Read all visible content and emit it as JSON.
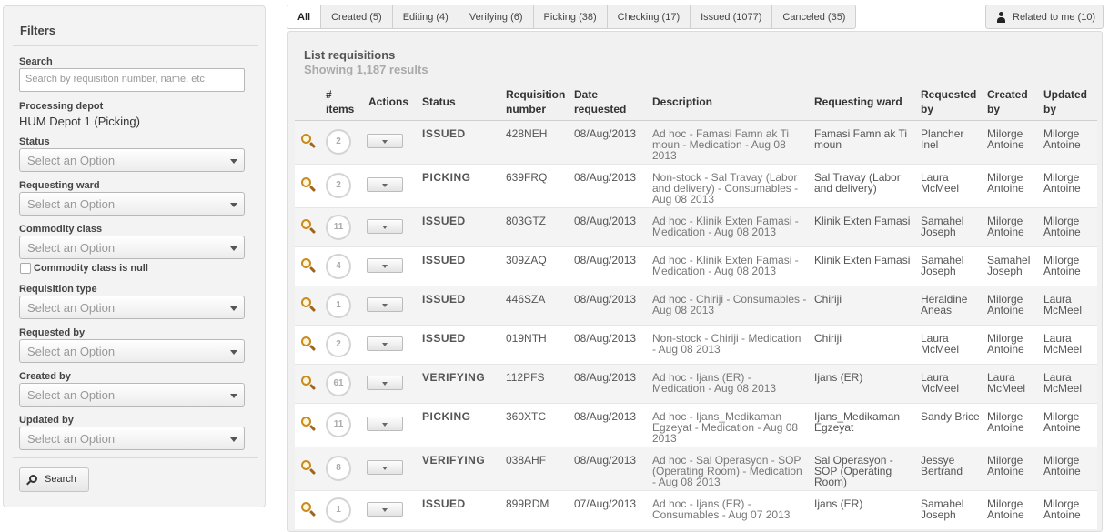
{
  "filters": {
    "title": "Filters",
    "search_label": "Search",
    "search_placeholder": "Search by requisition number, name, etc",
    "depot_label": "Processing depot",
    "depot_value": "HUM Depot 1 (Picking)",
    "status_label": "Status",
    "ward_label": "Requesting ward",
    "commodity_label": "Commodity class",
    "commodity_null_label": "Commodity class is null",
    "req_type_label": "Requisition type",
    "requested_by_label": "Requested by",
    "created_by_label": "Created by",
    "updated_by_label": "Updated by",
    "option_placeholder": "Select an Option",
    "search_button": "Search"
  },
  "tabs": [
    {
      "label": "All",
      "active": true
    },
    {
      "label": "Created (5)"
    },
    {
      "label": "Editing (4)"
    },
    {
      "label": "Verifying (6)"
    },
    {
      "label": "Picking (38)"
    },
    {
      "label": "Checking (17)"
    },
    {
      "label": "Issued (1077)"
    },
    {
      "label": "Canceled (35)"
    }
  ],
  "related_button": "Related to me (10)",
  "list": {
    "title": "List requisitions",
    "subtitle": "Showing 1,187 results"
  },
  "table": {
    "headers": {
      "items": "# items",
      "actions": "Actions",
      "status": "Status",
      "number": "Requisition number",
      "date": "Date requested",
      "description": "Description",
      "ward": "Requesting ward",
      "requested_by": "Requested by",
      "created_by": "Created by",
      "updated_by": "Updated by"
    },
    "rows": [
      {
        "items": "2",
        "status": "ISSUED",
        "number": "428NEH",
        "date": "08/Aug/2013",
        "description": "Ad hoc - Famasi Famn ak Ti moun - Medication - Aug 08 2013",
        "ward": "Famasi Famn ak Ti moun",
        "requested_by": "Plancher Inel",
        "created_by": "Milorge Antoine",
        "updated_by": "Milorge Antoine"
      },
      {
        "items": "2",
        "status": "PICKING",
        "number": "639FRQ",
        "date": "08/Aug/2013",
        "description": "Non-stock - Sal Travay (Labor and delivery) - Consumables - Aug 08 2013",
        "ward": "Sal Travay (Labor and delivery)",
        "requested_by": "Laura McMeel",
        "created_by": "Milorge Antoine",
        "updated_by": "Milorge Antoine"
      },
      {
        "items": "11",
        "status": "ISSUED",
        "number": "803GTZ",
        "date": "08/Aug/2013",
        "description": "Ad hoc - Klinik Exten Famasi - Medication - Aug 08 2013",
        "ward": "Klinik Exten Famasi",
        "requested_by": "Samahel Joseph",
        "created_by": "Milorge Antoine",
        "updated_by": "Milorge Antoine"
      },
      {
        "items": "4",
        "status": "ISSUED",
        "number": "309ZAQ",
        "date": "08/Aug/2013",
        "description": "Ad hoc - Klinik Exten Famasi - Medication - Aug 08 2013",
        "ward": "Klinik Exten Famasi",
        "requested_by": "Samahel Joseph",
        "created_by": "Samahel Joseph",
        "updated_by": "Milorge Antoine"
      },
      {
        "items": "1",
        "status": "ISSUED",
        "number": "446SZA",
        "date": "08/Aug/2013",
        "description": "Ad hoc - Chiriji - Consumables - Aug 08 2013",
        "ward": "Chiriji",
        "requested_by": "Heraldine Aneas",
        "created_by": "Milorge Antoine",
        "updated_by": "Laura McMeel"
      },
      {
        "items": "2",
        "status": "ISSUED",
        "number": "019NTH",
        "date": "08/Aug/2013",
        "description": "Non-stock - Chiriji - Medication - Aug 08 2013",
        "ward": "Chiriji",
        "requested_by": "Laura McMeel",
        "created_by": "Milorge Antoine",
        "updated_by": "Laura McMeel"
      },
      {
        "items": "61",
        "status": "VERIFYING",
        "number": "112PFS",
        "date": "08/Aug/2013",
        "description": "Ad hoc - Ijans (ER) - Medication - Aug 08 2013",
        "ward": "Ijans (ER)",
        "requested_by": "Laura McMeel",
        "created_by": "Laura McMeel",
        "updated_by": "Laura McMeel"
      },
      {
        "items": "11",
        "status": "PICKING",
        "number": "360XTC",
        "date": "08/Aug/2013",
        "description": "Ad hoc - Ijans_Medikaman Egzeyat - Medication - Aug 08 2013",
        "ward": "Ijans_Medikaman Egzeyat",
        "requested_by": "Sandy Brice",
        "created_by": "Milorge Antoine",
        "updated_by": "Milorge Antoine"
      },
      {
        "items": "8",
        "status": "VERIFYING",
        "number": "038AHF",
        "date": "08/Aug/2013",
        "description": "Ad hoc - Sal Operasyon - SOP (Operating Room) - Medication - Aug 08 2013",
        "ward": "Sal Operasyon - SOP (Operating Room)",
        "requested_by": "Jessye Bertrand",
        "created_by": "Milorge Antoine",
        "updated_by": "Milorge Antoine"
      },
      {
        "items": "1",
        "status": "ISSUED",
        "number": "899RDM",
        "date": "07/Aug/2013",
        "description": "Ad hoc - Ijans (ER) - Consumables - Aug 07 2013",
        "ward": "Ijans (ER)",
        "requested_by": "Samahel Joseph",
        "created_by": "Milorge Antoine",
        "updated_by": "Milorge Antoine"
      }
    ]
  }
}
